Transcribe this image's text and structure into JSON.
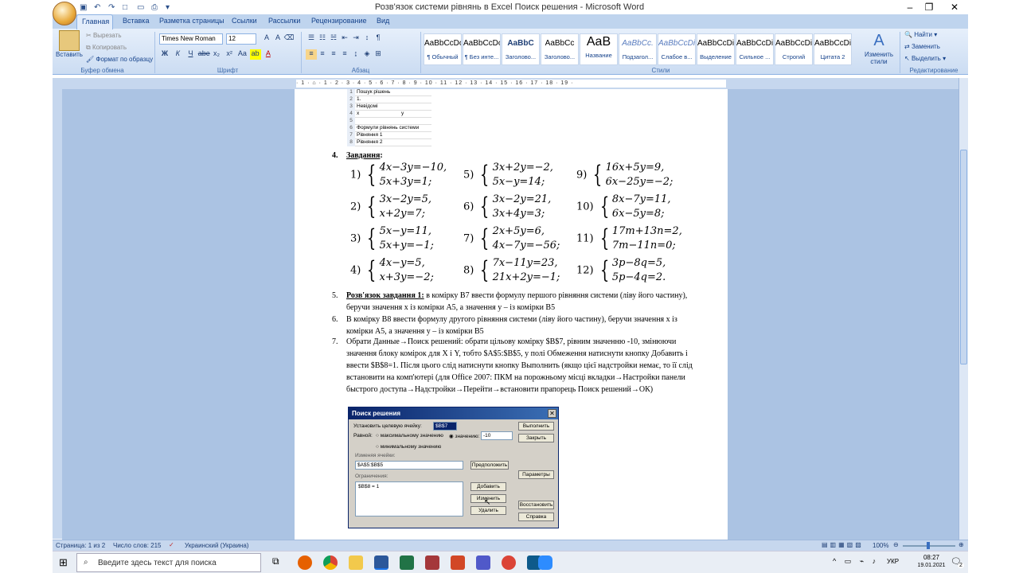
{
  "window": {
    "title": "Розв'язок системи рівнянь в Excel Поиск решения - Microsoft Word",
    "minimize": "–",
    "maximize": "❐",
    "close": "✕"
  },
  "ribbon": {
    "tabs": [
      "Главная",
      "Вставка",
      "Разметка страницы",
      "Ссылки",
      "Рассылки",
      "Рецензирование",
      "Вид"
    ],
    "clipboard": {
      "paste": "Вставить",
      "cut": "Вырезать",
      "copy": "Копировать",
      "format_painter": "Формат по образцу",
      "group": "Буфер обмена"
    },
    "font": {
      "name": "Times New Roman",
      "size": "12",
      "group": "Шрифт",
      "bold": "Ж",
      "italic": "К",
      "underline": "Ч",
      "strike": "abe",
      "sub": "x₂",
      "sup": "x²",
      "case": "Aa"
    },
    "paragraph": {
      "group": "Абзац"
    },
    "styles": {
      "group": "Стили",
      "items": [
        {
          "sample": "AaBbCcDc",
          "name": "¶ Обычный"
        },
        {
          "sample": "AaBbCcDc",
          "name": "¶ Без инте..."
        },
        {
          "sample": "AaBbC",
          "name": "Заголово..."
        },
        {
          "sample": "AaBbCc",
          "name": "Заголово..."
        },
        {
          "sample": "AaB",
          "name": "Название"
        },
        {
          "sample": "AaBbCc.",
          "name": "Подзагол..."
        },
        {
          "sample": "AaBbCcDi",
          "name": "Слабое в..."
        },
        {
          "sample": "AaBbCcDi",
          "name": "Выделение"
        },
        {
          "sample": "AaBbCcDi",
          "name": "Сильное ..."
        },
        {
          "sample": "AaBbCcDi",
          "name": "Строгий"
        },
        {
          "sample": "AaBbCcDi",
          "name": "Цитата 2"
        }
      ],
      "change_styles": "Изменить стили"
    },
    "editing": {
      "group": "Редактирование",
      "find": "Найти",
      "replace": "Заменить",
      "select": "Выделить"
    }
  },
  "ruler": "· 1 · ⌂ · 1 · 2 · 3 · 4 · 5 · 6 · 7 · 8 · 9 · 10 · 11 · 12 · 13 · 14 · 15 · 16 · 17 · 18 · 19 ·",
  "sheet": {
    "rows": [
      {
        "n": "1",
        "a": "Пошук рішень",
        "b": ""
      },
      {
        "n": "2",
        "a": "1.",
        "b": ""
      },
      {
        "n": "3",
        "a": "Невідомі",
        "b": ""
      },
      {
        "n": "4",
        "a": "x",
        "b": "y"
      },
      {
        "n": "5",
        "a": "",
        "b": ""
      },
      {
        "n": "6",
        "a": "Формули рівнянь системи",
        "b": ""
      },
      {
        "n": "7",
        "a": "Рівняння 1",
        "b": ""
      },
      {
        "n": "8",
        "a": "Рівняння 2",
        "b": ""
      }
    ]
  },
  "document": {
    "item4": {
      "num": "4.",
      "label": "Завдання"
    },
    "systems": [
      {
        "n": "1)",
        "l1": "4x−3y=−10,",
        "l2": "5x+3y=1;"
      },
      {
        "n": "5)",
        "l1": "3x+2y=−2,",
        "l2": "5x−y=14;"
      },
      {
        "n": "9)",
        "l1": "16x+5y=9,",
        "l2": "6x−25y=−2;"
      },
      {
        "n": "2)",
        "l1": "3x−2y=5,",
        "l2": "x+2y=7;"
      },
      {
        "n": "6)",
        "l1": "3x−2y=21,",
        "l2": "3x+4y=3;"
      },
      {
        "n": "10)",
        "l1": "8x−7y=11,",
        "l2": "6x−5y=8;"
      },
      {
        "n": "3)",
        "l1": "5x−y=11,",
        "l2": "5x+y=−1;"
      },
      {
        "n": "7)",
        "l1": "2x+5y=6,",
        "l2": "4x−7y=−56;"
      },
      {
        "n": "11)",
        "l1": "17m+13n=2,",
        "l2": "7m−11n=0;"
      },
      {
        "n": "4)",
        "l1": "4x−y=5,",
        "l2": "x+3y=−2;"
      },
      {
        "n": "8)",
        "l1": "7x−11y=23,",
        "l2": "21x+2y=−1;"
      },
      {
        "n": "12)",
        "l1": "3p−8q=5,",
        "l2": "5p−4q=2."
      }
    ],
    "item5": {
      "num": "5.",
      "lead": "Розв'язок завдання 1:",
      "text": " в комірку B7  ввести формулу першого рівняння системи (ліву його частину), беручи значення x із комірки A5, а значення y – із комірки B5"
    },
    "item6": {
      "num": "6.",
      "text": "В комірку B8 ввести формулу другого рівняння системи (ліву його частину), беручи значення x із комірки A5, а значення y – із комірки B5"
    },
    "item7": {
      "num": "7.",
      "text": "Обрати Данные→Поиск решений: обрати цільову комірку $B$7, рівним значенню -10, змінюючи значення блоку комірок для X і Y, тобто $A$5:$B$5, у полі Обмеження натиснути кнопку Добавить і ввести $B$8=1. Після цього слід натиснути кнопку Выполнить (якщо цієї надстройки немає, то її слід встановити на комп'ютері (для Office 2007: ПКМ на порожньому місці вкладки→Настройки панели быстрого доступа→Надстройки→Перейти→встановити прапорець Поиск решений→ОК)"
    }
  },
  "dialog": {
    "title": "Поиск решения",
    "target_label": "Установить целевую ячейку:",
    "target_value": "$B$7",
    "equal_label": "Равной:",
    "opt_max": "максимальному значению",
    "opt_value": "значению:",
    "opt_value_val": "-10",
    "opt_min": "минимальному значению",
    "changing_label": "Изменяя ячейки:",
    "changing_value": "$A$5:$B$5",
    "guess": "Предположить",
    "constraints_label": "Ограничения:",
    "constraint_1": "$B$8 = 1",
    "add": "Добавить",
    "change": "Изменить",
    "delete": "Удалить",
    "run": "Выполнить",
    "close": "Закрыть",
    "params": "Параметры",
    "restore": "Восстановить",
    "help": "Справка"
  },
  "status": {
    "page": "Страница: 1 из 2",
    "words": "Число слов: 215",
    "lang": "Украинский (Украина)",
    "zoom": "100%"
  },
  "taskbar": {
    "search_placeholder": "Введите здесь текст для поиска",
    "lang": "УКР",
    "time": "08:27",
    "date": "19.01.2021",
    "notif_count": "2"
  }
}
